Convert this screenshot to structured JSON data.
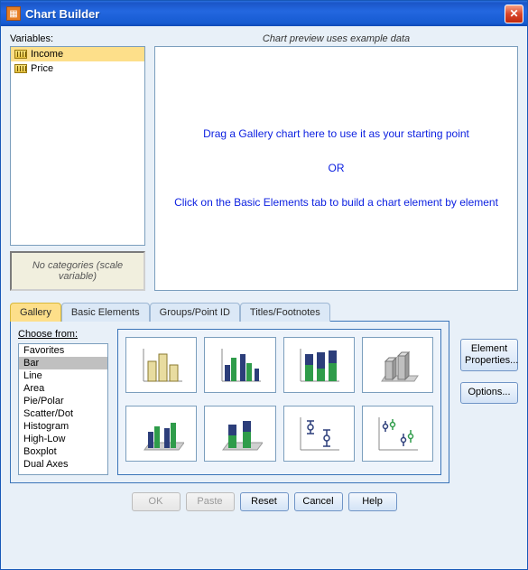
{
  "window": {
    "title": "Chart Builder"
  },
  "variables": {
    "label": "Variables:",
    "items": [
      {
        "name": "Income",
        "selected": true
      },
      {
        "name": "Price",
        "selected": false
      }
    ],
    "no_categories": "No categories (scale variable)"
  },
  "preview": {
    "label": "Chart preview uses example data",
    "line1": "Drag a Gallery chart here to use it as your starting point",
    "or": "OR",
    "line2": "Click on the Basic Elements tab to build a chart element by element"
  },
  "tabs": {
    "gallery": "Gallery",
    "basic": "Basic Elements",
    "groups": "Groups/Point ID",
    "titles": "Titles/Footnotes",
    "active": "gallery"
  },
  "gallery": {
    "choose_label": "Choose from:",
    "categories": [
      "Favorites",
      "Bar",
      "Line",
      "Area",
      "Pie/Polar",
      "Scatter/Dot",
      "Histogram",
      "High-Low",
      "Boxplot",
      "Dual Axes"
    ],
    "selected_category": "Bar",
    "thumbnails": [
      "bar-simple",
      "bar-clustered",
      "bar-stacked",
      "bar-3d",
      "bar-3d-clustered",
      "bar-3d-stacked",
      "error-bar-1",
      "error-bar-2"
    ]
  },
  "side_buttons": {
    "element_properties": "Element Properties...",
    "options": "Options..."
  },
  "bottom_buttons": {
    "ok": "OK",
    "paste": "Paste",
    "reset": "Reset",
    "cancel": "Cancel",
    "help": "Help"
  }
}
